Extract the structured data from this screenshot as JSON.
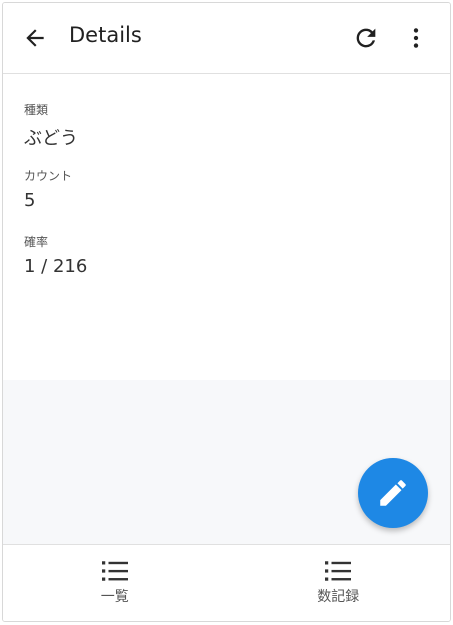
{
  "header": {
    "title": "Details",
    "back_icon": "arrow-left-icon",
    "refresh_icon": "refresh-icon",
    "more_icon": "more-vertical-icon"
  },
  "details": {
    "type_label": "種類",
    "type_value": "ぶどう",
    "count_label": "カウント",
    "count_value": "5",
    "probability_label": "確率",
    "probability_value": "1 / 216"
  },
  "fab": {
    "icon": "edit-icon",
    "color": "#1e88e5"
  },
  "bottom_nav": {
    "items": [
      {
        "label": "一覧",
        "icon": "list-icon"
      },
      {
        "label": "数記録",
        "icon": "list-icon"
      }
    ]
  }
}
